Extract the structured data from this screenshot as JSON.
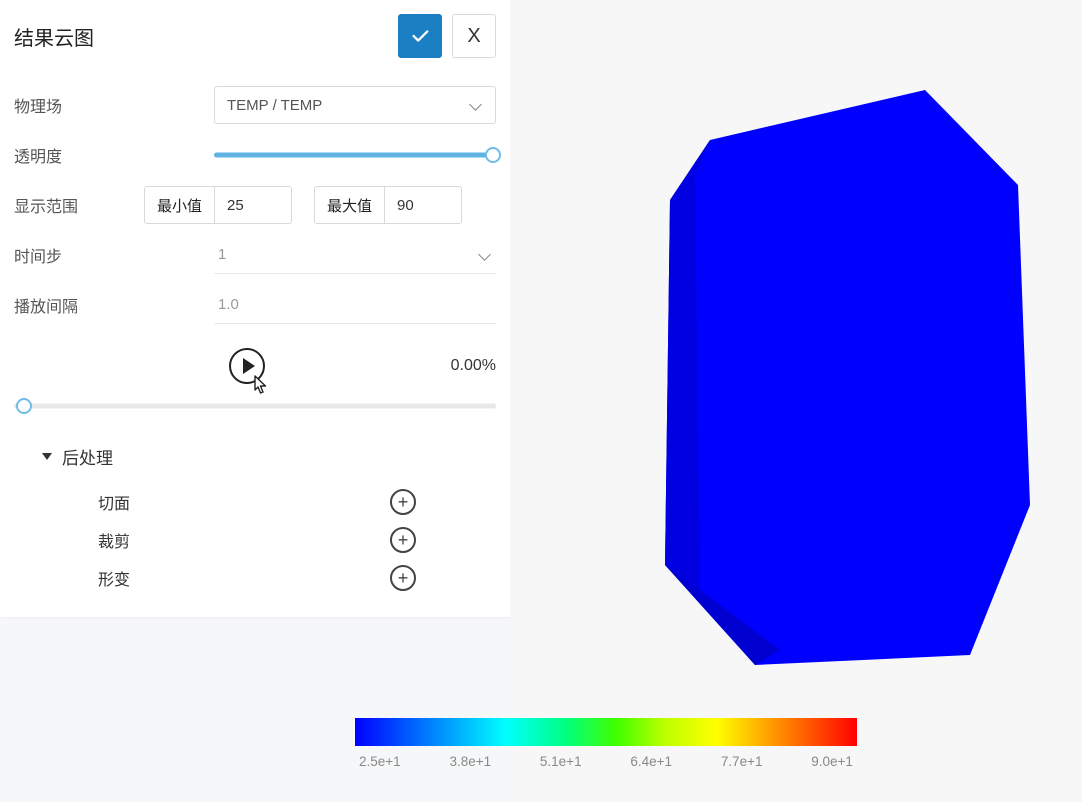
{
  "panel": {
    "title": "结果云图",
    "fields": {
      "physics_label": "物理场",
      "physics_value": "TEMP / TEMP",
      "opacity_label": "透明度",
      "range_label": "显示范围",
      "min_label": "最小值",
      "min_value": "25",
      "max_label": "最大值",
      "max_value": "90",
      "timestep_label": "时间步",
      "timestep_value": "1",
      "interval_label": "播放间隔",
      "interval_value": "1.0"
    },
    "progress_text": "0.00%",
    "postproc": {
      "header": "后处理",
      "items": [
        "切面",
        "裁剪",
        "形变"
      ]
    }
  },
  "legend": {
    "ticks": [
      "2.5e+1",
      "3.8e+1",
      "5.1e+1",
      "6.4e+1",
      "7.7e+1",
      "9.0e+1"
    ]
  }
}
